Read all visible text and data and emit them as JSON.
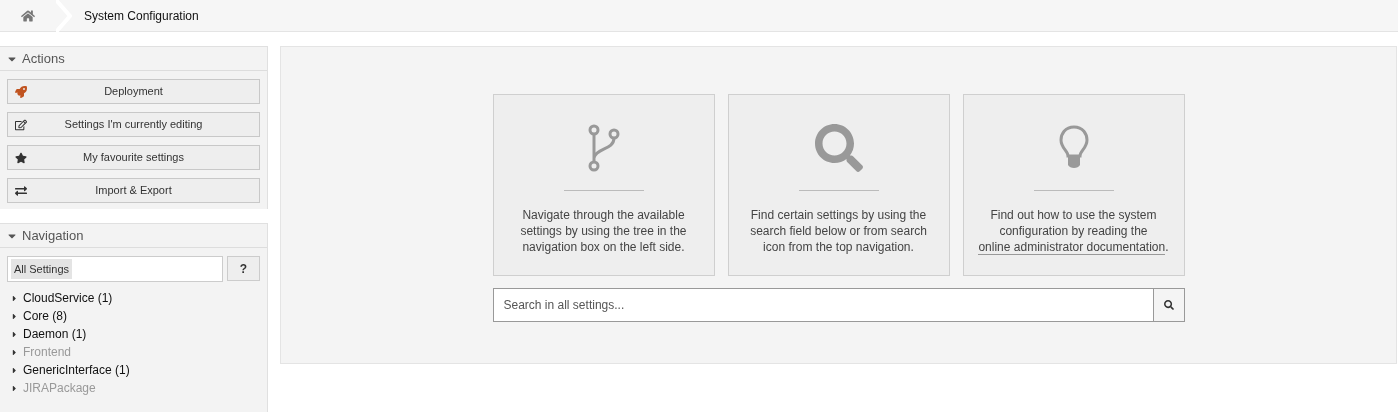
{
  "breadcrumb": {
    "title": "System Configuration"
  },
  "actions": {
    "title": "Actions",
    "buttons": [
      {
        "kind": "rocket",
        "label": "Deployment"
      },
      {
        "kind": "edit",
        "label": "Settings I'm currently editing"
      },
      {
        "kind": "star",
        "label": "My favourite settings"
      },
      {
        "kind": "exchange",
        "label": "Import & Export"
      }
    ]
  },
  "navigation": {
    "title": "Navigation",
    "filter_value": "All Settings",
    "help_button": "?",
    "tree": [
      {
        "label": "CloudService (1)",
        "disabled": false
      },
      {
        "label": "Core (8)",
        "disabled": false
      },
      {
        "label": "Daemon (1)",
        "disabled": false
      },
      {
        "label": "Frontend",
        "disabled": true
      },
      {
        "label": "GenericInterface (1)",
        "disabled": false
      },
      {
        "label": "JIRAPackage",
        "disabled": true
      }
    ]
  },
  "cards": [
    {
      "kind": "branch",
      "text": "Navigate through the available settings by using the tree in the navigation box on the left side."
    },
    {
      "kind": "search",
      "text": "Find certain settings by using the search field below or from search icon from the top navigation."
    },
    {
      "kind": "bulb",
      "text": "Find out how to use the system configuration by reading the",
      "link": "online administrator documentation",
      "after": "."
    }
  ],
  "search": {
    "placeholder": "Search in all settings..."
  }
}
